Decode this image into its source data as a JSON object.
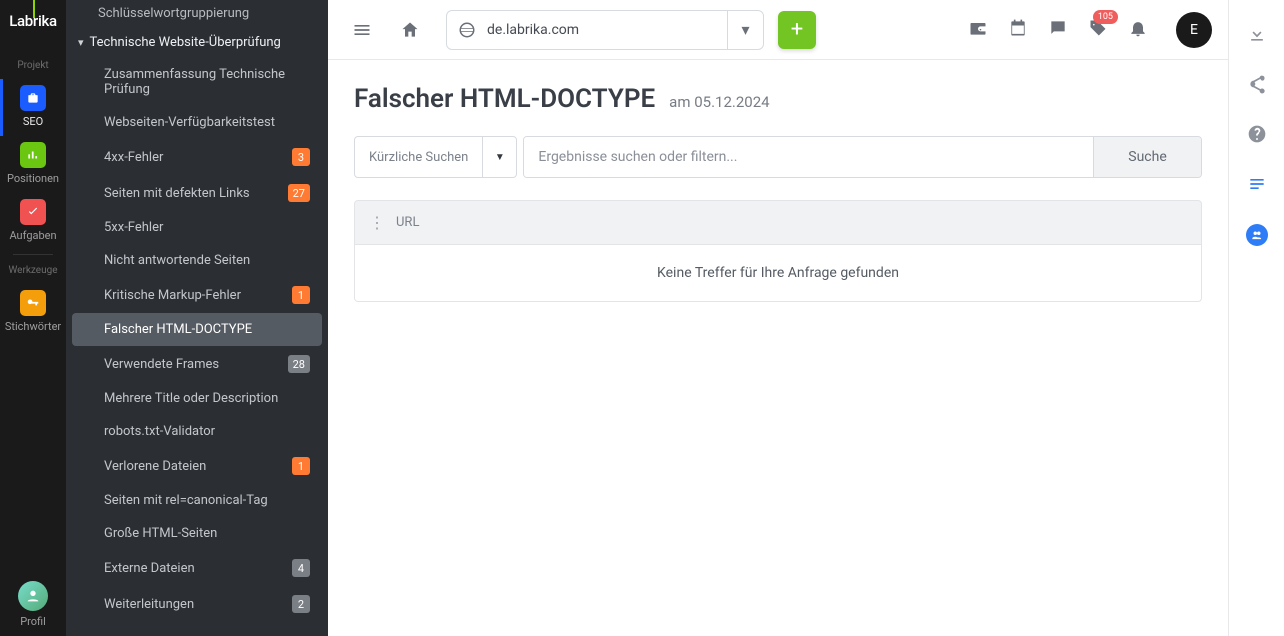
{
  "brand": "Labrika",
  "rail": {
    "projectLabel": "Projekt",
    "toolsLabel": "Werkzeuge",
    "items": {
      "seo": "SEO",
      "positions": "Positionen",
      "tasks": "Aufgaben",
      "keywords": "Stichwörter",
      "profile": "Profil"
    }
  },
  "sidebar": {
    "truncatedTop": "Schlüsselwortgruppierung",
    "groupTitle": "Technische Website-Überprüfung",
    "items": [
      {
        "label": "Zusammenfassung Technische Prüfung"
      },
      {
        "label": "Webseiten-Verfügbarkeitstest"
      },
      {
        "label": "4xx-Fehler",
        "badge": "3",
        "badgeStyle": "orange"
      },
      {
        "label": "Seiten mit defekten Links",
        "badge": "27",
        "badgeStyle": "orange"
      },
      {
        "label": "5xx-Fehler"
      },
      {
        "label": "Nicht antwortende Seiten"
      },
      {
        "label": "Kritische Markup-Fehler",
        "badge": "1",
        "badgeStyle": "orange"
      },
      {
        "label": "Falscher HTML-DOCTYPE",
        "active": true
      },
      {
        "label": "Verwendete Frames",
        "badge": "28",
        "badgeStyle": "gray"
      },
      {
        "label": "Mehrere Title oder Description"
      },
      {
        "label": "robots.txt-Validator"
      },
      {
        "label": "Verlorene Dateien",
        "badge": "1",
        "badgeStyle": "orange"
      },
      {
        "label": "Seiten mit rel=canonical-Tag"
      },
      {
        "label": "Große HTML-Seiten"
      },
      {
        "label": "Externe Dateien",
        "badge": "4",
        "badgeStyle": "gray"
      },
      {
        "label": "Weiterleitungen",
        "badge": "2",
        "badgeStyle": "gray"
      }
    ]
  },
  "topbar": {
    "domain": "de.labrika.com",
    "notifCount": "105",
    "avatarInitial": "E"
  },
  "page": {
    "title": "Falscher HTML-DOCTYPE",
    "date": "am 05.12.2024",
    "recentLabel": "Kürzliche Suchen",
    "searchPlaceholder": "Ergebnisse suchen oder filtern...",
    "searchBtn": "Suche",
    "urlHeader": "URL",
    "noResults": "Keine Treffer für Ihre Anfrage gefunden"
  }
}
